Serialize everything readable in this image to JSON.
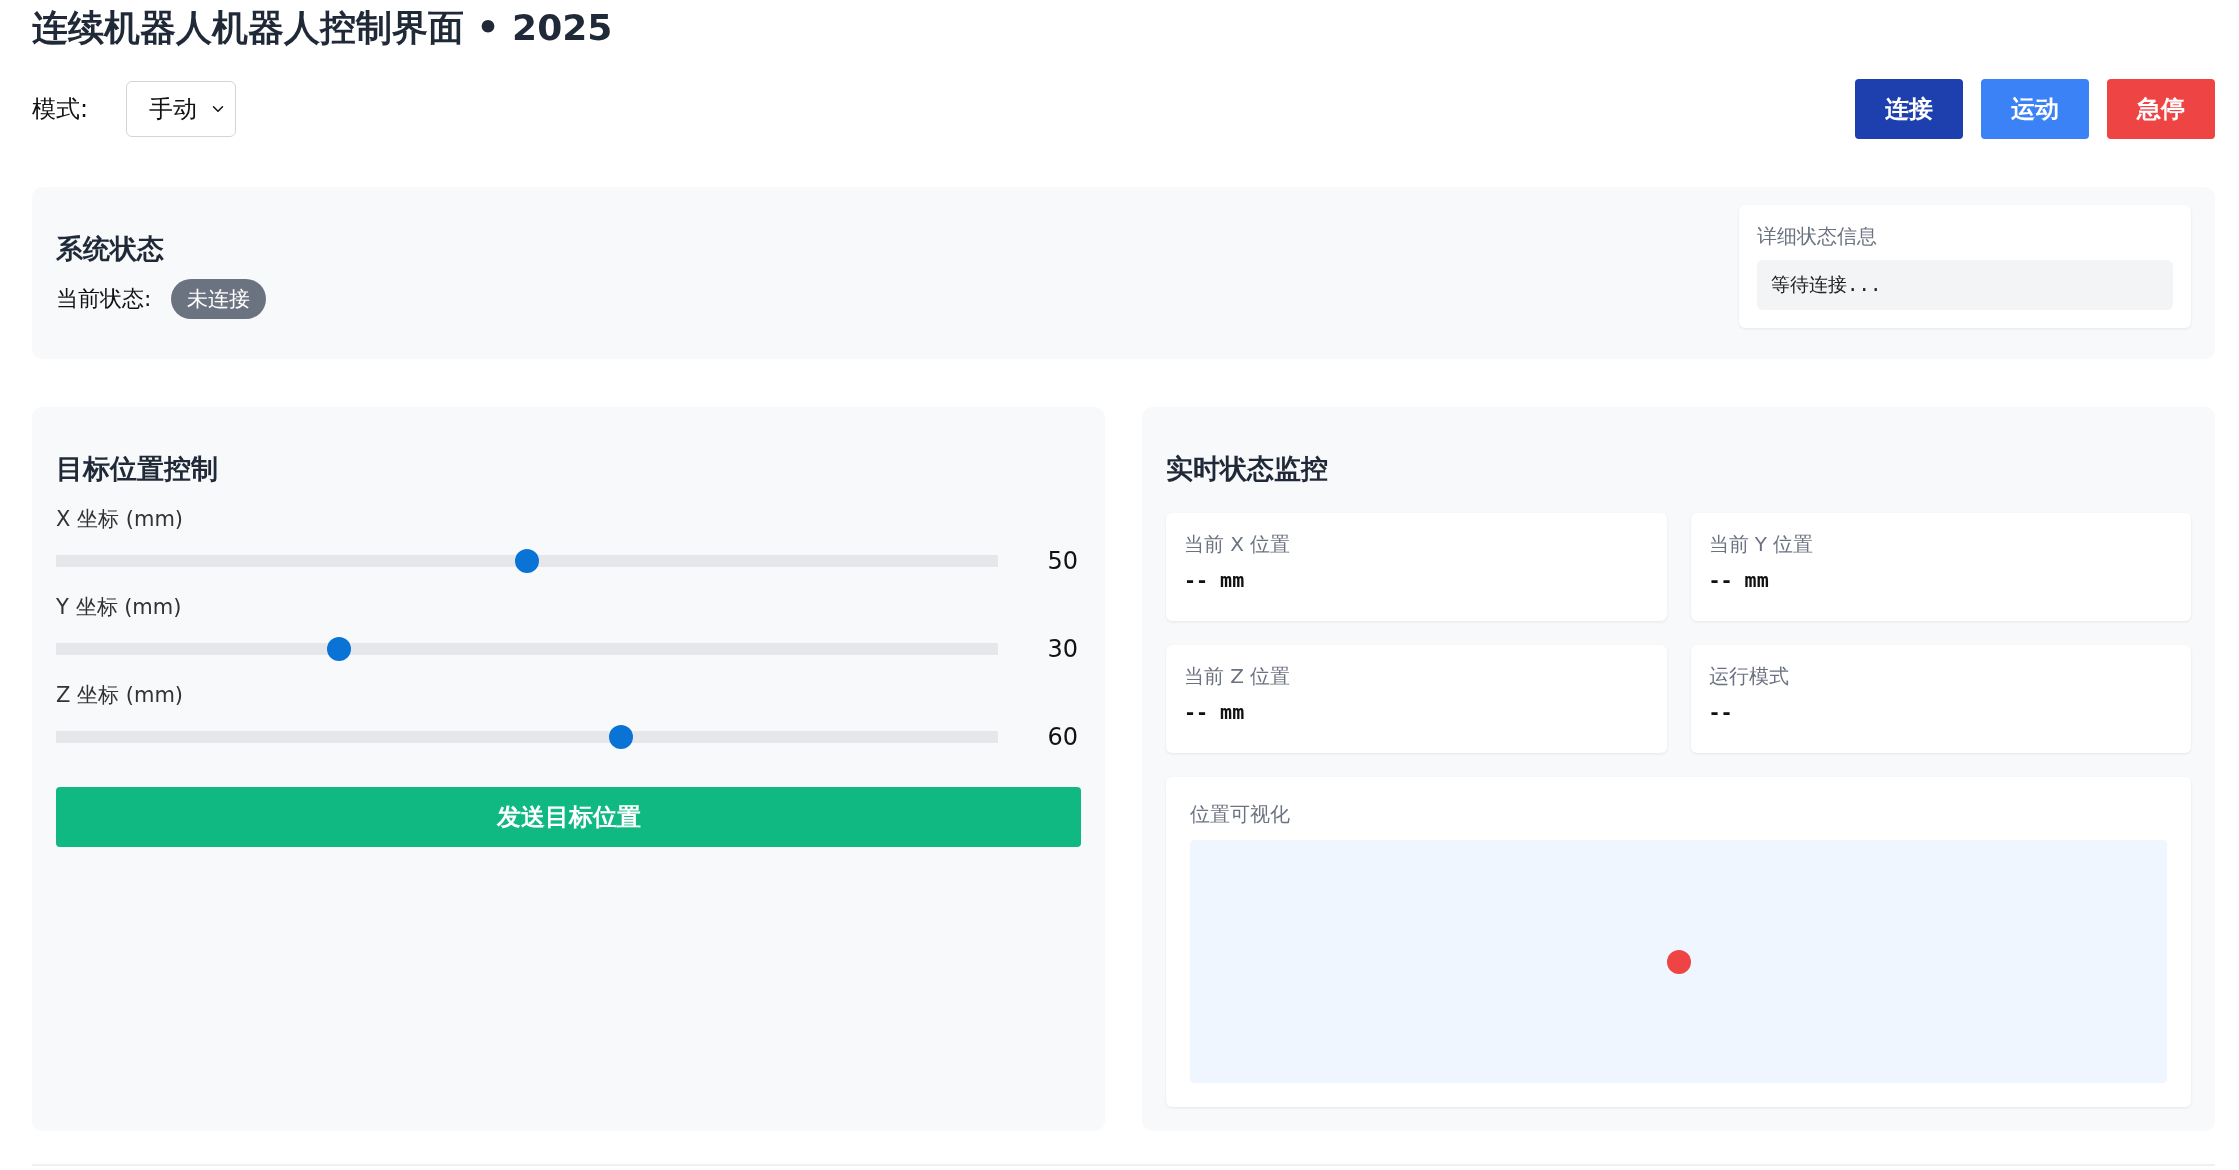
{
  "title": "连续机器人机器人控制界面 • 2025",
  "mode": {
    "label": "模式:",
    "value": "手动"
  },
  "buttons": [
    {
      "label": "连接",
      "kind": "connect"
    },
    {
      "label": "运动",
      "kind": "move"
    },
    {
      "label": "急停",
      "kind": "stop"
    }
  ],
  "system_status": {
    "heading": "系统状态",
    "label": "当前状态:",
    "badge": "未连接",
    "detail_label": "详细状态信息",
    "detail_text": "等待连接..."
  },
  "target_control": {
    "heading": "目标位置控制",
    "sliders": [
      {
        "label": "X 坐标 (mm)",
        "level": 0.5,
        "reading": "50"
      },
      {
        "label": "Y 坐标 (mm)",
        "level": 0.3,
        "reading": "30"
      },
      {
        "label": "Z 坐标 (mm)",
        "level": 0.6,
        "reading": "60"
      }
    ],
    "send_button": "发送目标位置"
  },
  "monitor": {
    "heading": "实时状态监控",
    "cards": [
      {
        "label": "当前 X 位置",
        "value": "-- mm"
      },
      {
        "label": "当前 Y 位置",
        "value": "-- mm"
      },
      {
        "label": "当前 Z 位置",
        "value": "-- mm"
      },
      {
        "label": "运行模式",
        "value": "--"
      }
    ],
    "visualization_label": "位置可视化"
  }
}
